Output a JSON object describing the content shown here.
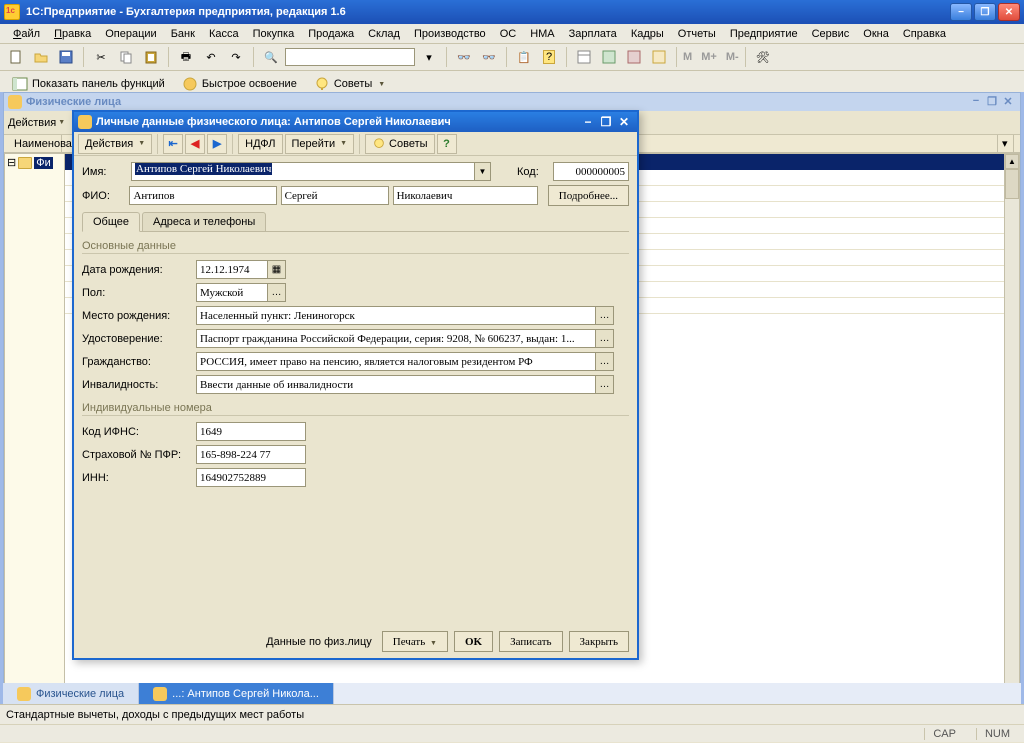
{
  "app": {
    "title": "1С:Предприятие - Бухгалтерия предприятия, редакция 1.6"
  },
  "menu": [
    "Файл",
    "Правка",
    "Операции",
    "Банк",
    "Касса",
    "Покупка",
    "Продажа",
    "Склад",
    "Производство",
    "ОС",
    "НМА",
    "Зарплата",
    "Кадры",
    "Отчеты",
    "Предприятие",
    "Сервис",
    "Окна",
    "Справка"
  ],
  "toolstrip": {
    "show_panel": "Показать панель функций",
    "quick": "Быстрое освоение",
    "tips": "Советы",
    "m": "M",
    "mplus": "M+",
    "mminus": "M-"
  },
  "bgwin": {
    "title": "Физические лица",
    "actions": "Действия",
    "header": "Наименова",
    "tree_root": "Фи"
  },
  "dialog": {
    "title": "Личные данные физического лица: Антипов Сергей Николаевич",
    "actions": "Действия",
    "ndfl": "НДФЛ",
    "goto": "Перейти",
    "tips": "Советы",
    "name_lbl": "Имя:",
    "name_val": "Антипов Сергей Николаевич",
    "code_lbl": "Код:",
    "code_val": "000000005",
    "fio_lbl": "ФИО:",
    "fio_last": "Антипов",
    "fio_first": "Сергей",
    "fio_mid": "Николаевич",
    "more_btn": "Подробнее...",
    "tab_general": "Общее",
    "tab_addr": "Адреса и телефоны",
    "group_main": "Основные данные",
    "dob_lbl": "Дата рождения:",
    "dob_val": "12.12.1974",
    "sex_lbl": "Пол:",
    "sex_val": "Мужской",
    "birthplace_lbl": "Место рождения:",
    "birthplace_val": "Населенный пункт: Лениногорск",
    "doc_lbl": "Удостоверение:",
    "doc_val": "Паспорт гражданина Российской Федерации, серия: 9208, № 606237, выдан: 1...",
    "citizen_lbl": "Гражданство:",
    "citizen_val": "РОССИЯ, имеет право на пенсию, является налоговым резидентом РФ",
    "disab_lbl": "Инвалидность:",
    "disab_val": "Ввести данные об инвалидности",
    "group_ids": "Индивидуальные номера",
    "ifns_lbl": "Код ИФНС:",
    "ifns_val": "1649",
    "pfr_lbl": "Страховой № ПФР:",
    "pfr_val": "165-898-224 77",
    "inn_lbl": "ИНН:",
    "inn_val": "164902752889",
    "footer": {
      "data": "Данные по физ.лицу",
      "print": "Печать",
      "ok": "OK",
      "save": "Записать",
      "close": "Закрыть"
    }
  },
  "taskbar": {
    "tab1": "Физические лица",
    "tab2": "...: Антипов Сергей Никола..."
  },
  "status": {
    "text": "Стандартные вычеты, доходы с предыдущих мест работы",
    "cap": "CAP",
    "num": "NUM"
  }
}
